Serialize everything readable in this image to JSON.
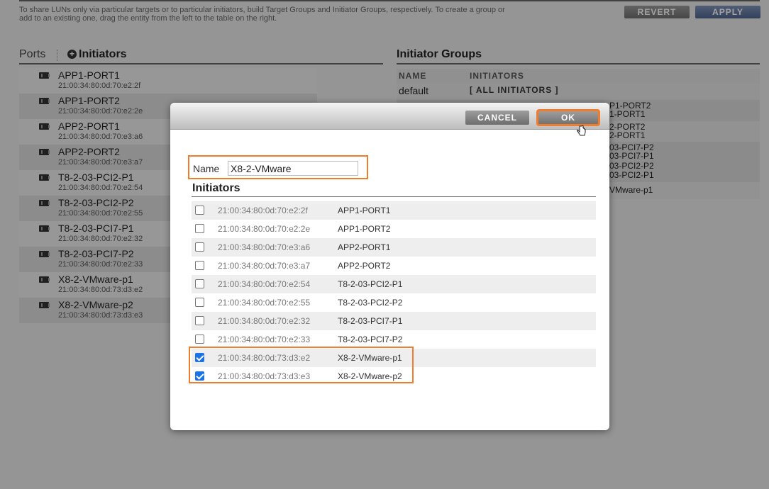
{
  "header": {
    "info": "To share LUNs only via particular targets or to particular initiators, build Target Groups and Initiator Groups, respectively. To create a group or add to an existing one, drag the entity from the left to the table on the right.",
    "revert": "REVERT",
    "apply": "APPLY"
  },
  "tabs": {
    "ports": "Ports",
    "initiators": "Initiators",
    "plus": "+"
  },
  "initiators_list": [
    {
      "name": "APP1-PORT1",
      "wwn": "21:00:34:80:0d:70:e2:2f"
    },
    {
      "name": "APP1-PORT2",
      "wwn": "21:00:34:80:0d:70:e2:2e"
    },
    {
      "name": "APP2-PORT1",
      "wwn": "21:00:34:80:0d:70:e3:a6"
    },
    {
      "name": "APP2-PORT2",
      "wwn": "21:00:34:80:0d:70:e3:a7"
    },
    {
      "name": "T8-2-03-PCI2-P1",
      "wwn": "21:00:34:80:0d:70:e2:54"
    },
    {
      "name": "T8-2-03-PCI2-P2",
      "wwn": "21:00:34:80:0d:70:e2:55"
    },
    {
      "name": "T8-2-03-PCI7-P1",
      "wwn": "21:00:34:80:0d:70:e2:32"
    },
    {
      "name": "T8-2-03-PCI7-P2",
      "wwn": "21:00:34:80:0d:70:e2:33"
    },
    {
      "name": "X8-2-VMware-p1",
      "wwn": "21:00:34:80:0d:73:d3:e2"
    },
    {
      "name": "X8-2-VMware-p2",
      "wwn": "21:00:34:80:0d:73:d3:e3"
    }
  ],
  "initiator_groups": {
    "title": "Initiator Groups",
    "col_name": "NAME",
    "col_initiators": "INITIATORS",
    "default_name": "default",
    "default_initiators": "[ ALL INITIATORS ]",
    "peek": [
      "P1-PORT2",
      "1-PORT1",
      "2-PORT2",
      "2-PORT1",
      "03-PCI7-P2",
      "03-PCI7-P1",
      "03-PCI2-P2",
      "03-PCI2-P1",
      "VMware-p1"
    ]
  },
  "dialog": {
    "cancel": "CANCEL",
    "ok": "OK",
    "name_label": "Name",
    "name_value": "X8-2-VMware",
    "initiators_title": "Initiators",
    "rows": [
      {
        "wwn": "21:00:34:80:0d:70:e2:2f",
        "alias": "APP1-PORT1",
        "checked": false
      },
      {
        "wwn": "21:00:34:80:0d:70:e2:2e",
        "alias": "APP1-PORT2",
        "checked": false
      },
      {
        "wwn": "21:00:34:80:0d:70:e3:a6",
        "alias": "APP2-PORT1",
        "checked": false
      },
      {
        "wwn": "21:00:34:80:0d:70:e3:a7",
        "alias": "APP2-PORT2",
        "checked": false
      },
      {
        "wwn": "21:00:34:80:0d:70:e2:54",
        "alias": "T8-2-03-PCI2-P1",
        "checked": false
      },
      {
        "wwn": "21:00:34:80:0d:70:e2:55",
        "alias": "T8-2-03-PCI2-P2",
        "checked": false
      },
      {
        "wwn": "21:00:34:80:0d:70:e2:32",
        "alias": "T8-2-03-PCI7-P1",
        "checked": false
      },
      {
        "wwn": "21:00:34:80:0d:70:e2:33",
        "alias": "T8-2-03-PCI7-P2",
        "checked": false
      },
      {
        "wwn": "21:00:34:80:0d:73:d3:e2",
        "alias": "X8-2-VMware-p1",
        "checked": true
      },
      {
        "wwn": "21:00:34:80:0d:73:d3:e3",
        "alias": "X8-2-VMware-p2",
        "checked": true
      }
    ]
  },
  "colors": {
    "highlight": "#ef7d2d",
    "checkbox": "#1a73e8",
    "apply": "#50658e"
  }
}
